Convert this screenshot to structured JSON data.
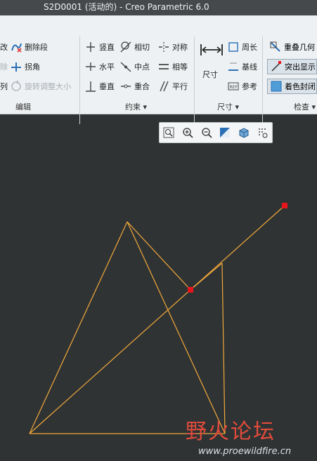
{
  "window": {
    "title": "S2D0001 (活动的) - Creo Parametric 6.0"
  },
  "ribbon": {
    "edit_group": {
      "label": "编辑",
      "partial_left": [
        "改",
        "除",
        "列"
      ],
      "items": [
        "删除段",
        "拐角",
        "旋转调整大小"
      ]
    },
    "constraint_group": {
      "label": "约束",
      "items": [
        "竖直",
        "相切",
        "对称",
        "水平",
        "中点",
        "相等",
        "垂直",
        "重合",
        "平行"
      ]
    },
    "dimension_group": {
      "label": "尺寸",
      "main_button": "尺寸",
      "items": [
        "周长",
        "基线",
        "参考"
      ]
    },
    "inspect_group": {
      "label": "检查",
      "items": [
        "重叠几何",
        "突出显示",
        "着色封闭"
      ]
    }
  },
  "view_toolbar": {
    "icons": [
      "refit-icon",
      "zoom-in-icon",
      "zoom-out-icon",
      "repaint-icon",
      "display-style-icon",
      "sketch-display-filter-icon"
    ]
  },
  "watermark": {
    "text": "野火论坛",
    "url": "www.proewildfire.cn"
  },
  "colors": {
    "sketch_line": "#f2a93b",
    "highlight_point": "#e8161c",
    "background": "#2f3334"
  }
}
